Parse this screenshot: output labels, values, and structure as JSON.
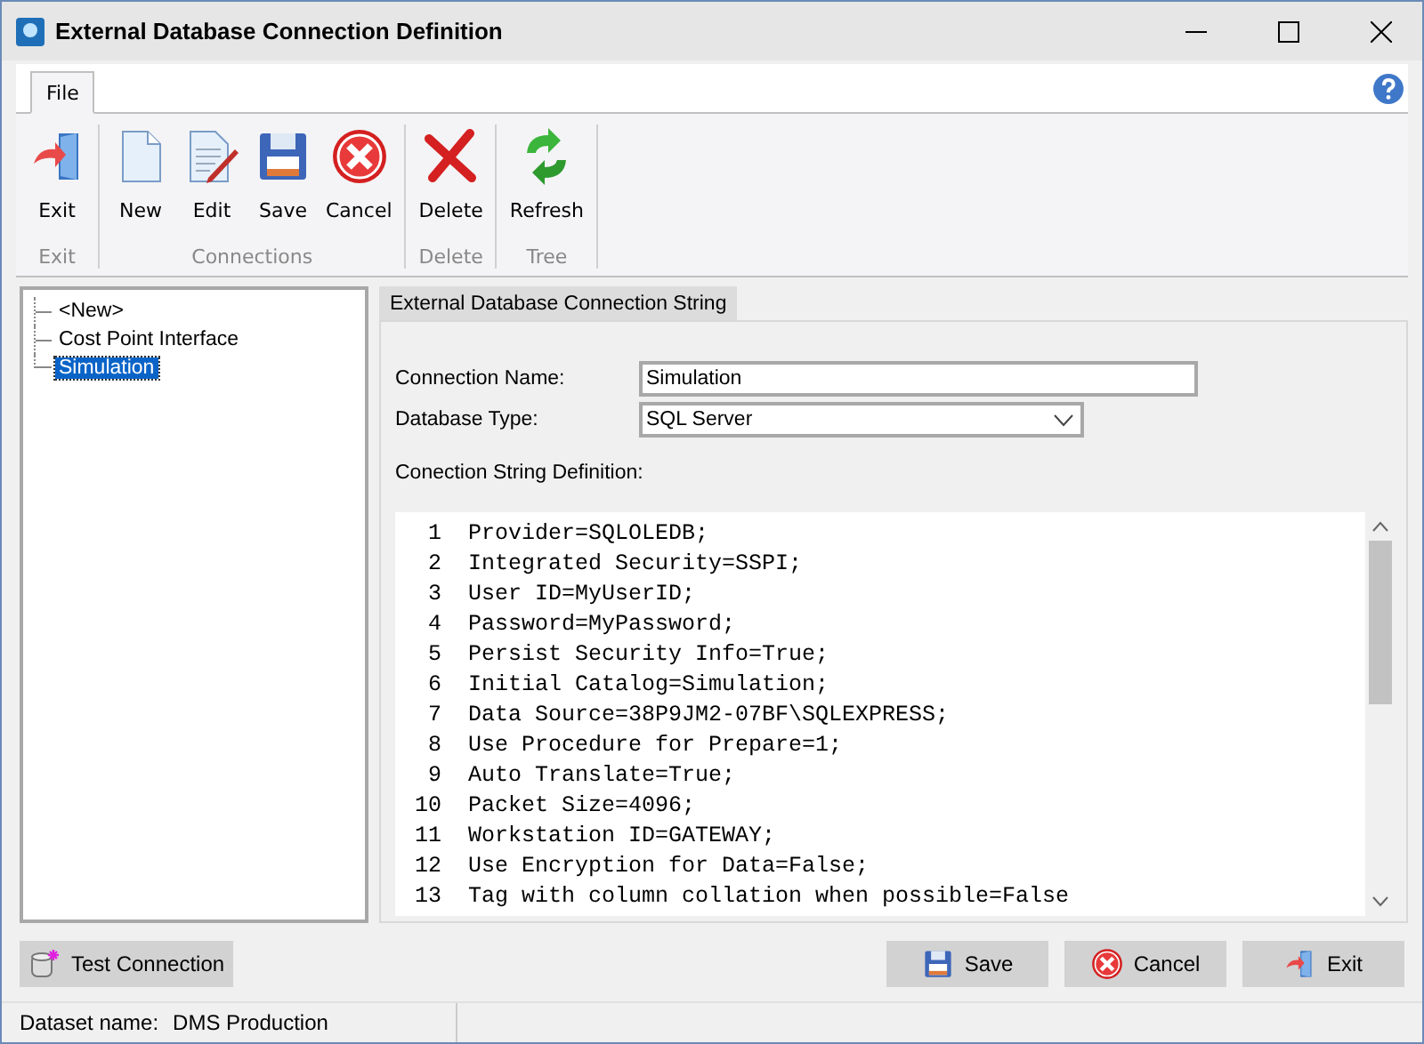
{
  "window": {
    "title": "External Database Connection Definition"
  },
  "ribbon": {
    "tabs": [
      {
        "label": "File",
        "selected": true
      }
    ],
    "groups": [
      {
        "label": "Exit",
        "buttons": [
          {
            "label": "Exit",
            "kind": "exit"
          }
        ]
      },
      {
        "label": "Connections",
        "buttons": [
          {
            "label": "New",
            "kind": "new"
          },
          {
            "label": "Edit",
            "kind": "edit"
          },
          {
            "label": "Save",
            "kind": "save"
          },
          {
            "label": "Cancel",
            "kind": "cancel"
          }
        ]
      },
      {
        "label": "Delete",
        "buttons": [
          {
            "label": "Delete",
            "kind": "delete"
          }
        ]
      },
      {
        "label": "Tree",
        "buttons": [
          {
            "label": "Refresh",
            "kind": "refresh"
          }
        ]
      }
    ]
  },
  "tree": {
    "items": [
      {
        "label": "<New>",
        "selected": false
      },
      {
        "label": "Cost Point Interface",
        "selected": false
      },
      {
        "label": "Simulation",
        "selected": true
      }
    ]
  },
  "panel": {
    "tab": "External Database Connection String",
    "connection_name": {
      "label": "Connection Name:",
      "value": "Simulation"
    },
    "database_type": {
      "label": "Database Type:",
      "value": "SQL Server"
    },
    "definition_label": "Conection String Definition:",
    "lines": [
      {
        "number": "1",
        "text": "Provider=SQLOLEDB;"
      },
      {
        "number": "2",
        "text": "Integrated Security=SSPI;"
      },
      {
        "number": "3",
        "text": "User ID=MyUserID;"
      },
      {
        "number": "4",
        "text": "Password=MyPassword;"
      },
      {
        "number": "5",
        "text": "Persist Security Info=True;"
      },
      {
        "number": "6",
        "text": "Initial Catalog=Simulation;"
      },
      {
        "number": "7",
        "text": "Data Source=38P9JM2-07BF\\SQLEXPRESS;"
      },
      {
        "number": "8",
        "text": "Use Procedure for Prepare=1;"
      },
      {
        "number": "9",
        "text": "Auto Translate=True;"
      },
      {
        "number": "10",
        "text": "Packet Size=4096;"
      },
      {
        "number": "11",
        "text": "Workstation ID=GATEWAY;"
      },
      {
        "number": "12",
        "text": "Use Encryption for Data=False;"
      },
      {
        "number": "13",
        "text": "Tag with column collation when possible=False"
      }
    ]
  },
  "buttons": [
    {
      "label": "Test Connection",
      "kind": "test"
    },
    {
      "label": "Save",
      "kind": "save"
    },
    {
      "label": "Cancel",
      "kind": "cancel"
    },
    {
      "label": "Exit",
      "kind": "exit"
    }
  ],
  "status_bar": {
    "label": "Dataset name:",
    "value": "DMS Production"
  }
}
